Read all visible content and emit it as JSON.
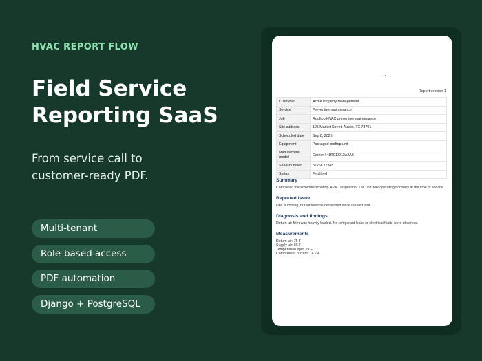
{
  "hero": {
    "eyebrow": "HVAC REPORT FLOW",
    "title_line1": "Field Service",
    "title_line2": "Reporting SaaS",
    "subtitle_line1": "From service call to",
    "subtitle_line2": "customer-ready PDF."
  },
  "features": [
    "Multi-tenant",
    "Role-based access",
    "PDF automation",
    "Django + PostgreSQL"
  ],
  "report": {
    "version": "Report version 1",
    "rows": [
      {
        "label": "Customer",
        "value": "Acme Property Management"
      },
      {
        "label": "Service",
        "value": "Preventive maintenance"
      },
      {
        "label": "Job",
        "value": "Rooftop HVAC preventive maintenance"
      },
      {
        "label": "Site address",
        "value": "125 Market Street, Austin, TX 78701"
      },
      {
        "label": "Scheduled date",
        "value": "Sep 8, 2026"
      },
      {
        "label": "Equipment",
        "value": "Packaged rooftop unit"
      },
      {
        "label": "Manufacturer / model",
        "value": "Carrier / 48TCED12A2A6"
      },
      {
        "label": "Serial number",
        "value": "3726C12345"
      },
      {
        "label": "Status",
        "value": "Finalized"
      }
    ],
    "summary_title": "Summary",
    "summary_text": "Completed the scheduled rooftop HVAC inspection. The unit was operating normally at the time of service.",
    "issue_title": "Reported issue",
    "issue_text": "Unit is cooling, but airflow has decreased since the last visit.",
    "diag_title": "Diagnosis and findings",
    "diag_text": "Return-air filter was heavily loaded. No refrigerant leaks or electrical faults were observed.",
    "meas_title": "Measurements",
    "measurements": [
      "Return air: 75 F",
      "Supply air: 56 F",
      "Temperature split: 19 F",
      "Compressor current: 14.2 A"
    ]
  }
}
